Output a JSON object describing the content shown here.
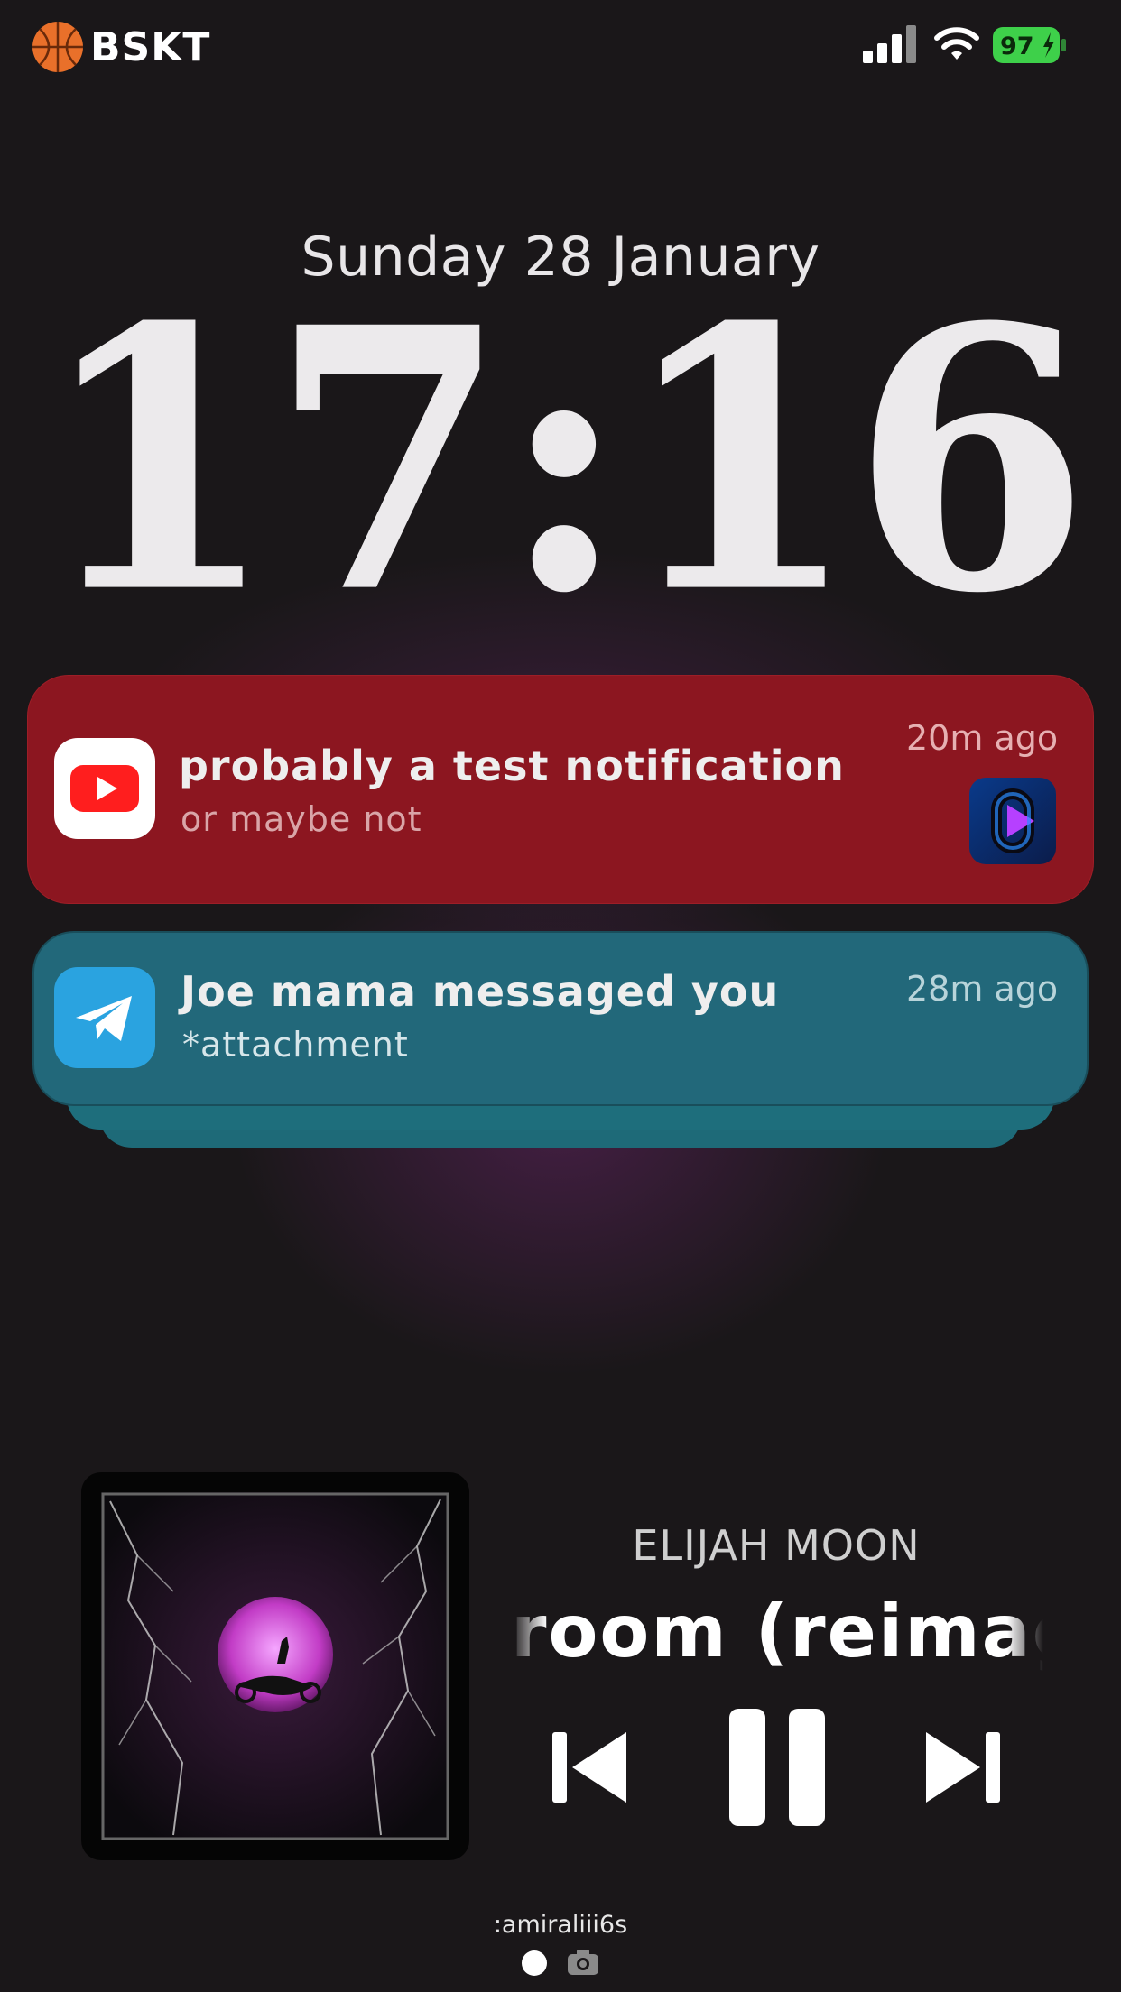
{
  "status_bar": {
    "carrier": "BSKT",
    "battery": "97"
  },
  "lockscreen": {
    "date": "Sunday 28 January",
    "time": "17:16"
  },
  "notifications": [
    {
      "app": "YouTube",
      "title": "probably a test notification",
      "body": "or maybe not",
      "time": "20m ago",
      "color": "#8c1620"
    },
    {
      "app": "Telegram",
      "title": "Joe mama messaged you",
      "body": "*attachment",
      "time": "28m ago",
      "color": "#22687a"
    }
  ],
  "now_playing": {
    "artist": "ELIJAH MOON",
    "song": "room (reimagi"
  },
  "footer": {
    "username": ":amiraliii6s"
  }
}
